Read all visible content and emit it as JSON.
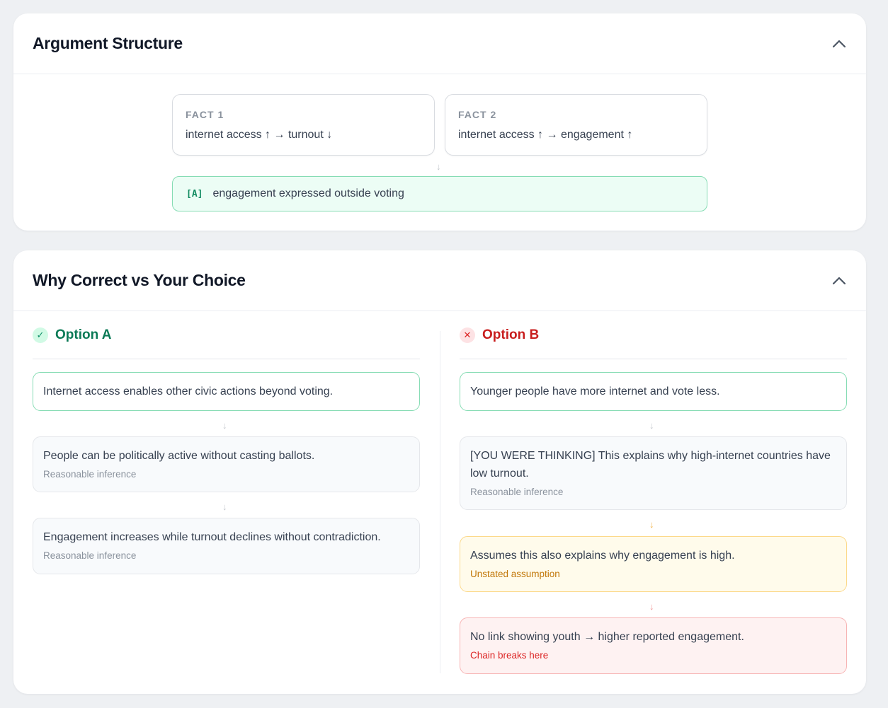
{
  "argument_structure": {
    "title": "Argument Structure",
    "facts": [
      {
        "label": "FACT 1",
        "text": "internet access ↑ → turnout ↓"
      },
      {
        "label": "FACT 2",
        "text": "internet access ↑ → engagement ↑"
      }
    ],
    "conclusion": {
      "tag": "[A]",
      "text": "engagement expressed outside voting"
    }
  },
  "comparison": {
    "title": "Why Correct vs Your Choice",
    "option_a": {
      "title": "Option A",
      "status_icon": "check-icon",
      "steps": [
        {
          "text": "Internet access enables other civic actions beyond voting."
        },
        {
          "text": "People can be politically active without casting ballots.",
          "tag": "Reasonable inference"
        },
        {
          "text": "Engagement increases while turnout declines without contradiction.",
          "tag": "Reasonable inference"
        }
      ]
    },
    "option_b": {
      "title": "Option B",
      "status_icon": "x-icon",
      "steps": [
        {
          "text": "Younger people have more internet and vote less."
        },
        {
          "text": "[YOU WERE THINKING] This explains why high-internet countries have low turnout.",
          "tag": "Reasonable inference"
        },
        {
          "text": "Assumes this also explains why engagement is high.",
          "tag": "Unstated assumption"
        },
        {
          "text": "No link showing youth → higher reported engagement.",
          "tag": "Chain breaks here"
        }
      ]
    }
  },
  "colors": {
    "green_accent": "#0b7a56",
    "red_accent": "#c81e1e",
    "warning_accent": "#c2780a",
    "conclusion_bg": "#ecfdf5"
  }
}
